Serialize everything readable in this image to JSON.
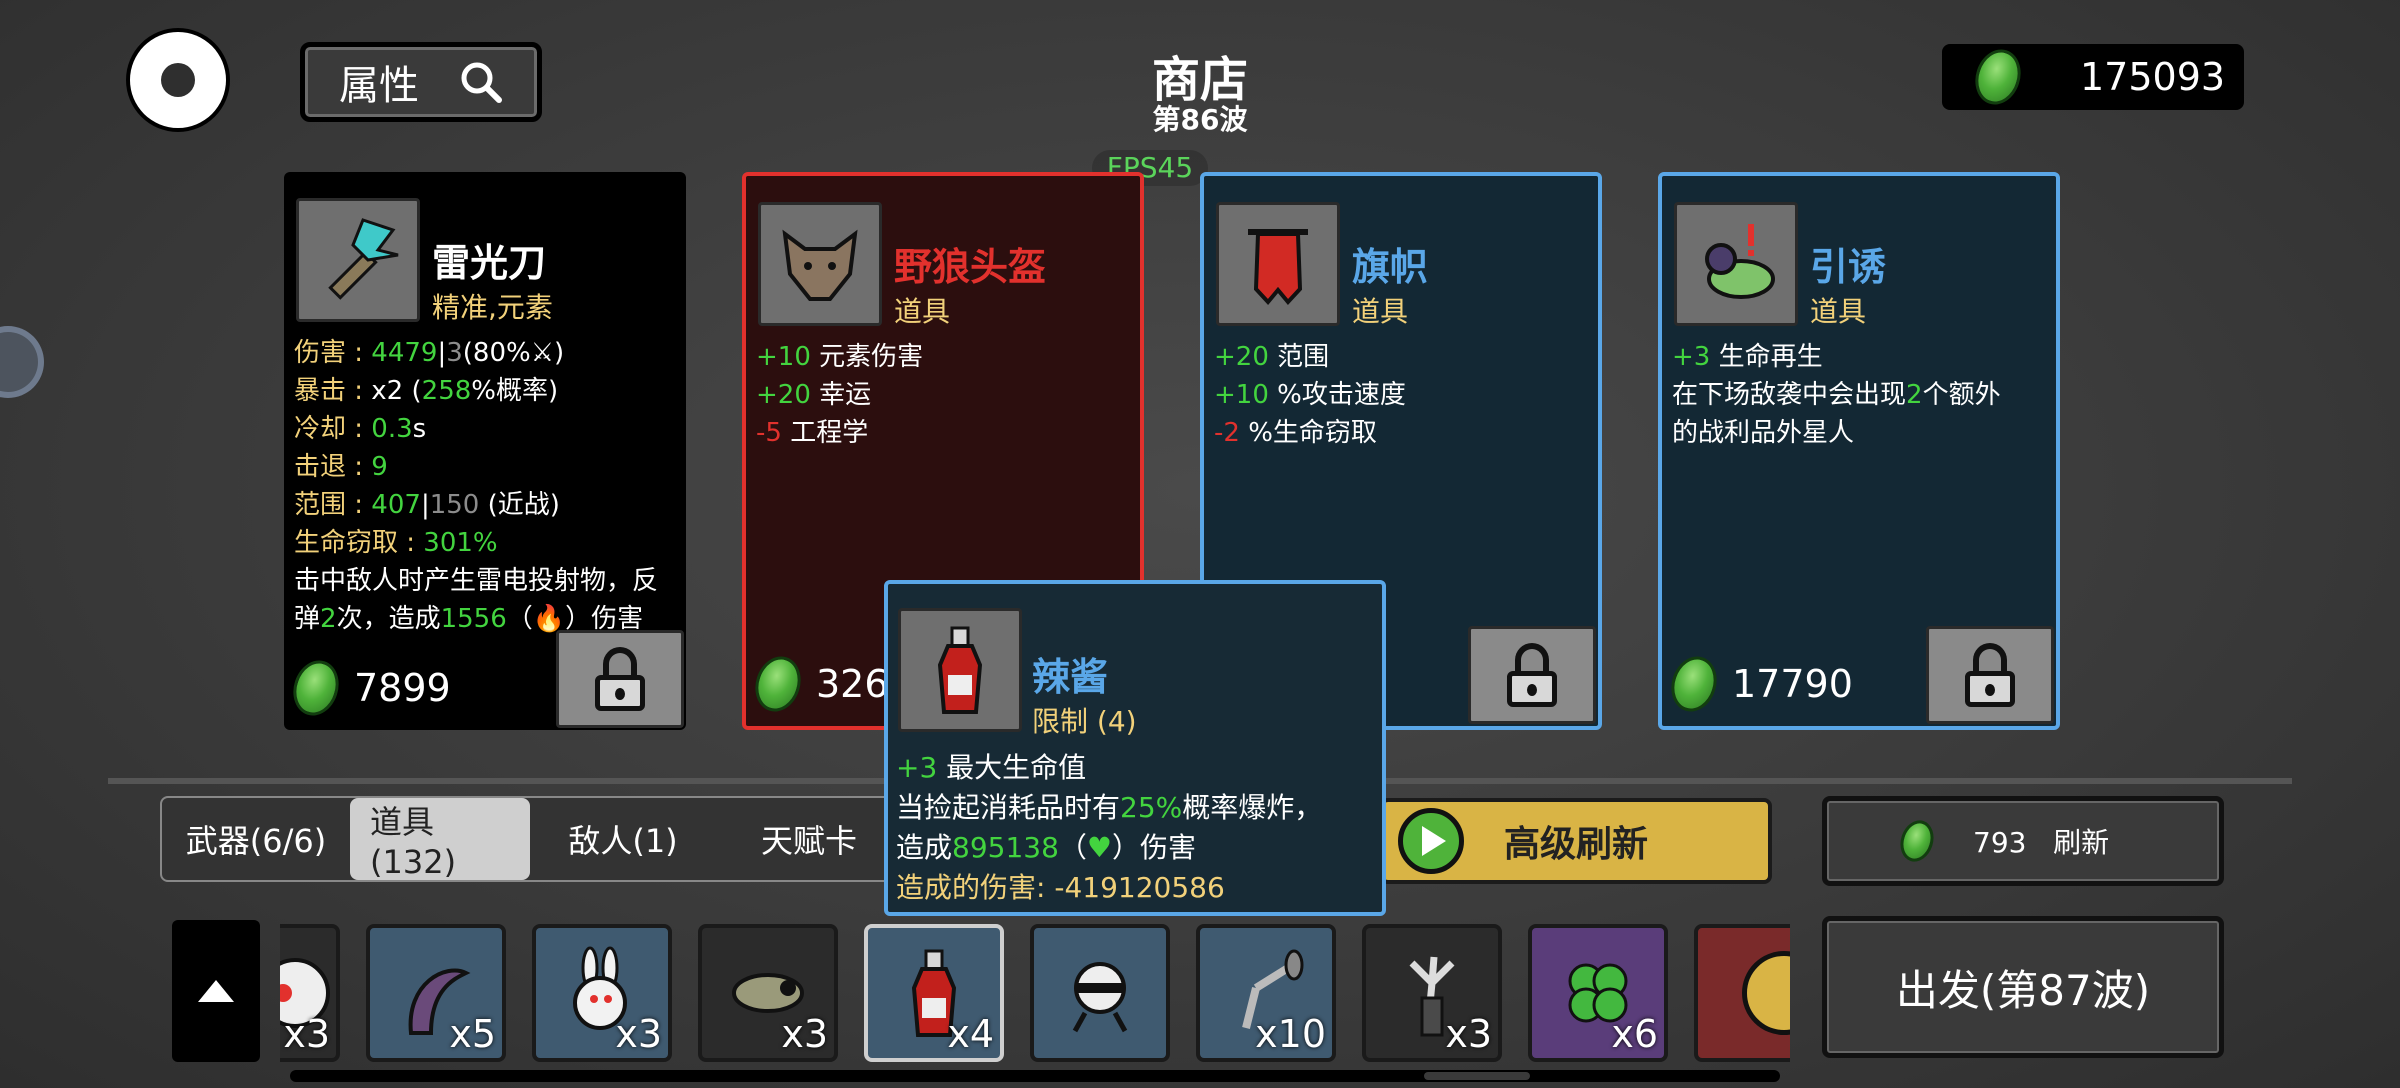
{
  "header": {
    "title": "商店",
    "wave": "第86波",
    "fps": "FPS45",
    "attributes_label": "属性",
    "money": "175093"
  },
  "cards": [
    {
      "name": "雷光刀",
      "type": "精准,元素",
      "price": "7899",
      "icon": "lightning-blade-icon",
      "name_color": "#ffffff",
      "border": "#000000",
      "lines": [
        {
          "a": "伤害 : ",
          "b": "4479",
          "c": "|",
          "d": "3",
          "e": "(80%",
          "f": "⚔",
          "g": ")"
        },
        {
          "a": "暴击 : ",
          "b": "x2",
          "c": " (",
          "d": "258",
          "e": "%概率)"
        },
        {
          "a": "冷却 : ",
          "b": "0.3",
          "c": "s"
        },
        {
          "a": "击退 : ",
          "b": "9"
        },
        {
          "a": "范围 : ",
          "b": "407",
          "c": "|",
          "d": "150",
          "e": " (近战)"
        },
        {
          "a": "生命窃取 : ",
          "b": "301%"
        }
      ],
      "desc1": "击中敌人时产生雷电投射物，反",
      "desc2a": "弹",
      "desc2b": "2",
      "desc2c": "次，造成",
      "desc2d": "1556",
      "desc2e": "（",
      "desc2f": "🔥",
      "desc2g": "）伤害"
    },
    {
      "name": "野狼头盔",
      "type": "道具",
      "price": "326",
      "icon": "wolf-helmet-icon",
      "name_color": "#e2312d",
      "lines": [
        {
          "v": "+10",
          "t": " 元素伤害"
        },
        {
          "v": "+20",
          "t": " 幸运"
        },
        {
          "v": "-5",
          "t": " 工程学"
        }
      ]
    },
    {
      "name": "旗帜",
      "type": "道具",
      "icon": "banner-icon",
      "name_color": "#5aa7e8",
      "lines": [
        {
          "v": "+20",
          "t": " 范围"
        },
        {
          "v": "+10",
          "t": " %攻击速度"
        },
        {
          "v": "-2",
          "t": " %生命窃取"
        }
      ]
    },
    {
      "name": "引诱",
      "type": "道具",
      "price": "17790",
      "icon": "lure-icon",
      "name_color": "#5aa7e8",
      "lines": [
        {
          "v": "+3",
          "t": " 生命再生"
        }
      ],
      "desc1a": "在下场敌袭中会出现",
      "desc1b": "2",
      "desc1c": "个额外",
      "desc2": "的战利品外星人"
    }
  ],
  "tooltip": {
    "name": "辣酱",
    "type": "限制 (4)",
    "icon": "hot-sauce-icon",
    "l1v": "+3",
    "l1t": " 最大生命值",
    "l2a": "当捡起消耗品时有",
    "l2b": "25%",
    "l2c": "概率爆炸，",
    "l3a": "造成",
    "l3b": "895138",
    "l3c": "（",
    "l3d": "♥",
    "l3e": "）伤害",
    "l4": "造成的伤害: -419120586"
  },
  "tabs": [
    {
      "label": "武器(6/6)"
    },
    {
      "label": "道具(132)"
    },
    {
      "label": "敌人(1)"
    },
    {
      "label": "天赋卡"
    }
  ],
  "actions": {
    "advanced_refresh": "高级刷新",
    "refresh_cost": "793",
    "refresh_label": "刷新",
    "go": "出发(第87波)"
  },
  "inventory": [
    {
      "icon": "skull-icon",
      "count": "x3",
      "bg": "#2b2b2b"
    },
    {
      "icon": "tentacle-icon",
      "count": "x5",
      "bg": "#3f5a70"
    },
    {
      "icon": "rabbit-icon",
      "count": "x3",
      "bg": "#3f5a70"
    },
    {
      "icon": "snail-icon",
      "count": "x3",
      "bg": "#2b2b2b"
    },
    {
      "icon": "hot-sauce-icon",
      "count": "x4",
      "bg": "#3f5a70"
    },
    {
      "icon": "ninja-bot-icon",
      "count": "",
      "bg": "#3f5a70"
    },
    {
      "icon": "pickaxe-icon",
      "count": "x10",
      "bg": "#3f5a70"
    },
    {
      "icon": "claw-icon",
      "count": "x3",
      "bg": "#2b2b2b"
    },
    {
      "icon": "clover-icon",
      "count": "x6",
      "bg": "#5a3d7a"
    },
    {
      "icon": "gold-coin-icon",
      "count": "",
      "bg": "#7a2a2a"
    }
  ],
  "colors": {
    "green": "#43d43f",
    "red": "#e2312d",
    "blue": "#5aa7e8",
    "gold": "#d9b445"
  }
}
